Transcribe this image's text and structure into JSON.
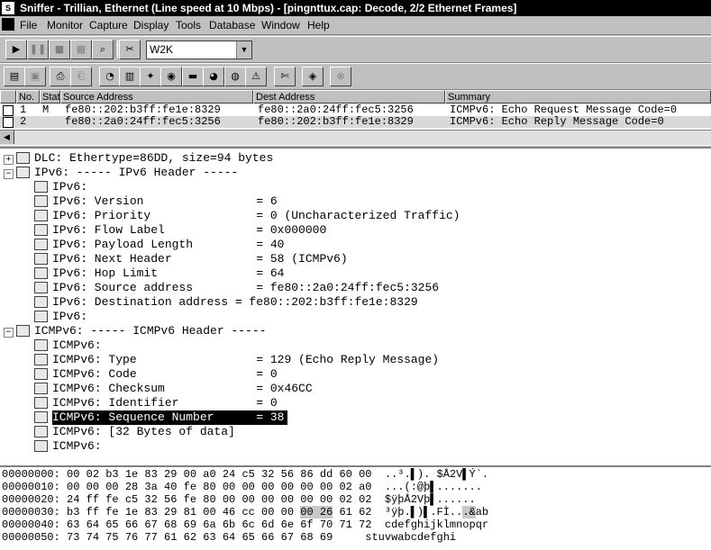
{
  "window": {
    "title": "Sniffer - Trillian, Ethernet (Line speed at 10 Mbps) - [pingnttux.cap: Decode, 2/2 Ethernet Frames]"
  },
  "menu": [
    "File",
    "Monitor",
    "Capture",
    "Display",
    "Tools",
    "Database",
    "Window",
    "Help"
  ],
  "toolbar": {
    "adapter_value": "W2K"
  },
  "summary": {
    "columns": [
      "No.",
      "Status",
      "Source Address",
      "Dest Address",
      "Summary"
    ],
    "rows": [
      {
        "no": "1",
        "status": "M",
        "source": "fe80::202:b3ff:fe1e:8329",
        "dest": "fe80::2a0:24ff:fec5:3256",
        "summary": "ICMPv6: Echo Request Message Code=0"
      },
      {
        "no": "2",
        "status": "",
        "source": "fe80::2a0:24ff:fec5:3256",
        "dest": "fe80::202:b3ff:fe1e:8329",
        "summary": "ICMPv6: Echo Reply Message Code=0"
      }
    ]
  },
  "detail": {
    "lines": [
      "DLC: Ethertype=86DD, size=94 bytes",
      "IPv6: ----- IPv6 Header -----",
      "IPv6:",
      "IPv6: Version                = 6",
      "IPv6: Priority               = 0 (Uncharacterized Traffic)",
      "IPv6: Flow Label             = 0x000000",
      "IPv6: Payload Length         = 40",
      "IPv6: Next Header            = 58 (ICMPv6)",
      "IPv6: Hop Limit              = 64",
      "IPv6: Source address         = fe80::2a0:24ff:fec5:3256",
      "IPv6: Destination address = fe80::202:b3ff:fe1e:8329",
      "IPv6:",
      "ICMPv6: ----- ICMPv6 Header -----",
      "ICMPv6:",
      "ICMPv6: Type                 = 129 (Echo Reply Message)",
      "ICMPv6: Code                 = 0",
      "ICMPv6: Checksum             = 0x46CC",
      "ICMPv6: Identifier           = 0",
      "ICMPv6: Sequence Number      = 38",
      "ICMPv6: [32 Bytes of data]",
      "ICMPv6:"
    ]
  },
  "hex": {
    "lines": [
      {
        "offset": "00000000:",
        "bytes": "00 02 b3 1e 83 29 00 a0 24 c5 32 56 86 dd 60 00",
        "ascii": "..³.▌). $Å2V▌Ý`."
      },
      {
        "offset": "00000010:",
        "bytes": "00 00 00 28 3a 40 fe 80 00 00 00 00 00 00 02 a0",
        "ascii": "...(:@þ▌......."
      },
      {
        "offset": "00000020:",
        "bytes": "24 ff fe c5 32 56 fe 80 00 00 00 00 00 00 02 02",
        "ascii": "$ÿþÅ2Vþ▌......"
      },
      {
        "offset": "00000030:",
        "bytes_pre": "b3 ff fe 1e 83 29 81 00 46 cc 00 00 ",
        "bytes_hl": "00 26",
        "bytes_post": " 61 62",
        "ascii_pre": "³ÿþ.▌)▌.FÌ..",
        "ascii_hl": ".&",
        "ascii_post": "ab"
      },
      {
        "offset": "00000040:",
        "bytes": "63 64 65 66 67 68 69 6a 6b 6c 6d 6e 6f 70 71 72",
        "ascii": "cdefghijklmnopqr"
      },
      {
        "offset": "00000050:",
        "bytes": "73 74 75 76 77 61 62 63 64 65 66 67 68 69",
        "ascii": "stuvwabcdefghi"
      }
    ]
  }
}
